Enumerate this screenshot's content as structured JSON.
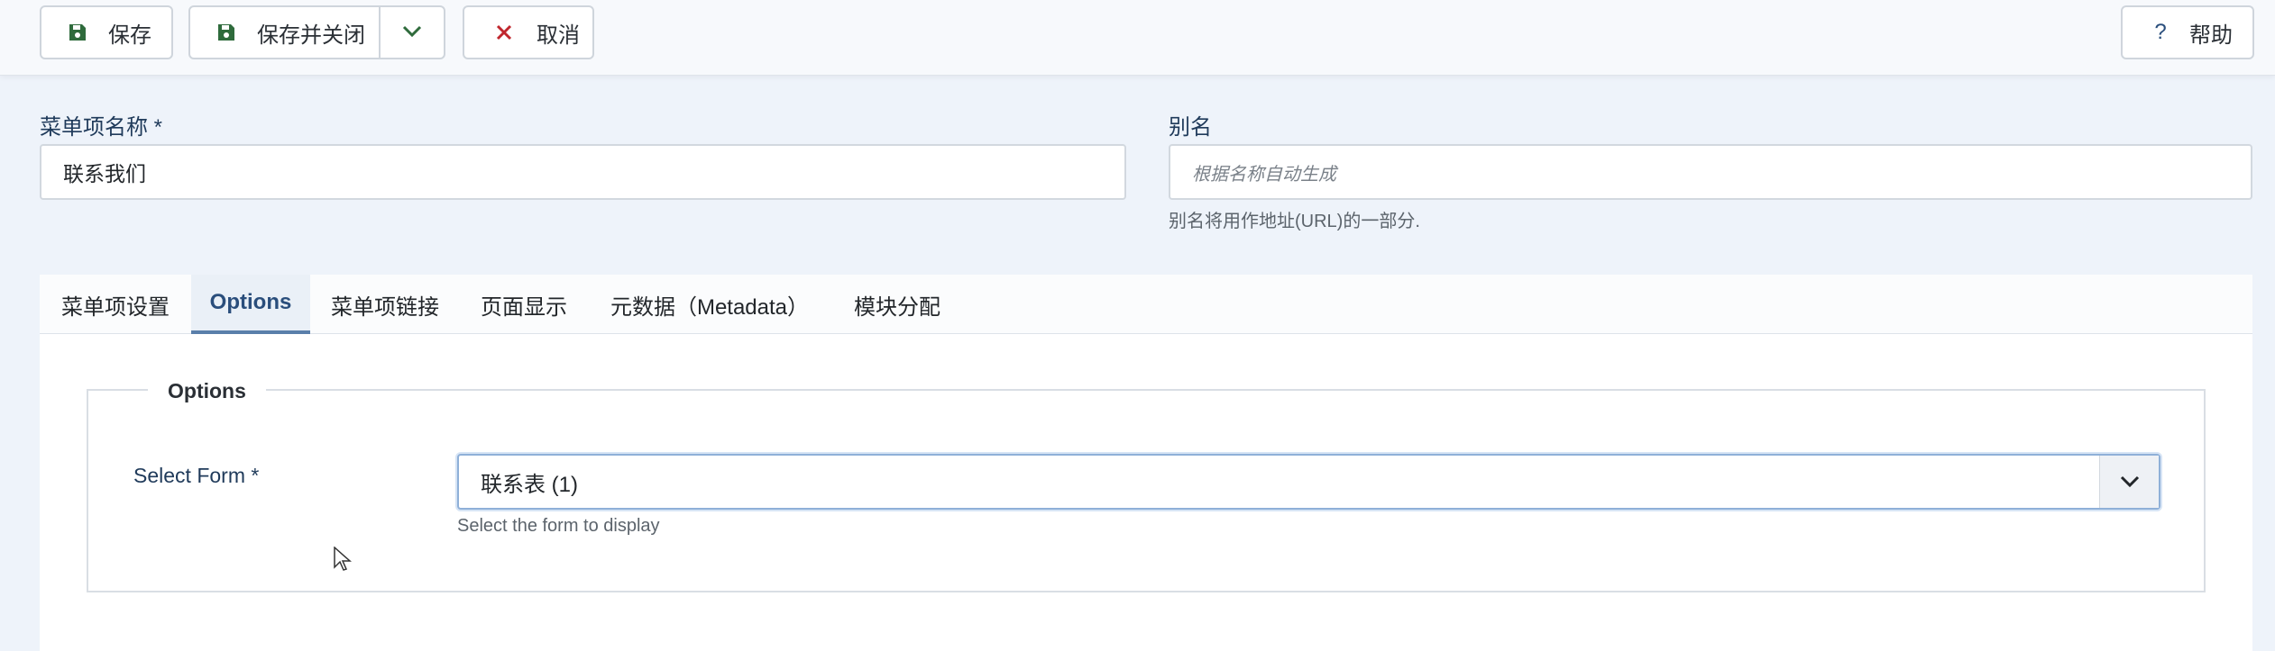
{
  "toolbar": {
    "save": {
      "label": "保存",
      "icon": "save-icon"
    },
    "save_close": {
      "label": "保存并关闭",
      "icon": "save-icon",
      "dropdown_icon": "chevron-down-icon"
    },
    "cancel": {
      "label": "取消",
      "icon": "close-icon"
    },
    "help": {
      "label": "帮助",
      "icon": "help-icon"
    }
  },
  "form": {
    "title": {
      "label": "菜单项名称 *",
      "value": "联系我们"
    },
    "alias": {
      "label": "别名",
      "placeholder": "根据名称自动生成",
      "hint": "别名将用作地址(URL)的一部分."
    }
  },
  "tabs": [
    {
      "label": "菜单项设置",
      "active": false
    },
    {
      "label": "Options",
      "active": true
    },
    {
      "label": "菜单项链接",
      "active": false
    },
    {
      "label": "页面显示",
      "active": false
    },
    {
      "label": "元数据（Metadata）",
      "active": false
    },
    {
      "label": "模块分配",
      "active": false
    }
  ],
  "options": {
    "legend": "Options",
    "select_form": {
      "label": "Select Form *",
      "value": "联系表 (1)",
      "hint": "Select the form to display"
    }
  },
  "colors": {
    "save_icon": "#2f6b3c",
    "cancel_icon": "#c0262d",
    "accent": "#5a7faa"
  }
}
